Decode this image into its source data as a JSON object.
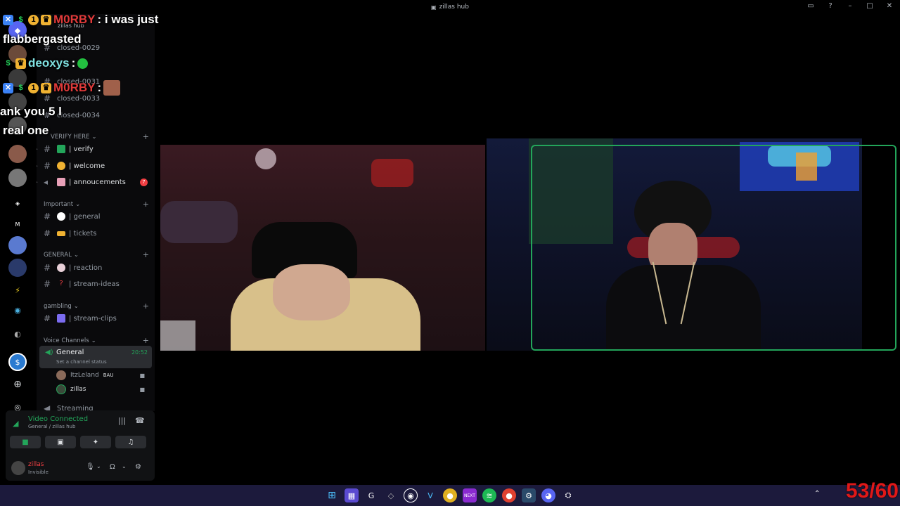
{
  "window": {
    "title": "zillas hub"
  },
  "chat_overlay": [
    {
      "user": "M0RBY",
      "text": ": i was just"
    },
    {
      "text": "flabbergasted"
    },
    {
      "user": "deoxys",
      "text": ":"
    },
    {
      "user": "M0RBY",
      "text": ":"
    },
    {
      "text": "ank you 5 l"
    },
    {
      "text": "real one"
    }
  ],
  "sidebar": {
    "server_name": "zillas hub",
    "closed": [
      "closed-0029",
      "closed-0031",
      "closed-0033",
      "closed-0034"
    ],
    "cat_verify": "VERIFY HERE",
    "verify_channels": [
      {
        "label": "| verify",
        "icon": "check-icon",
        "color": "#23a55a"
      },
      {
        "label": "| welcome",
        "icon": "wave-icon",
        "color": "#f0b232"
      },
      {
        "label": "| annoucements",
        "icon": "megaphone-icon",
        "color": "#e8a0b8",
        "badge": "7"
      }
    ],
    "cat_important": "Important",
    "important_channels": [
      {
        "label": "| general",
        "icon": "speech-icon",
        "color": "#ffffff"
      },
      {
        "label": "| tickets",
        "icon": "ticket-icon",
        "color": "#f0b232"
      }
    ],
    "cat_general": "GENERAL",
    "general_channels": [
      {
        "label": "| reaction",
        "icon": "face-icon",
        "color": "#e8d0d8"
      },
      {
        "label": "| stream-ideas",
        "icon": "question-icon",
        "color": "#f23f43"
      }
    ],
    "cat_gambling": "gambling",
    "gambling_channels": [
      {
        "label": "| stream-clips",
        "icon": "clip-icon",
        "color": "#7b6cf0"
      }
    ],
    "cat_voice": "Voice Channels",
    "voice": {
      "name": "General",
      "time": "20:52",
      "status": "Set a channel status",
      "users": [
        {
          "name": "ItzLeland",
          "tag": "BAU"
        },
        {
          "name": "zillas"
        }
      ],
      "next": "Streaming"
    }
  },
  "voice_panel": {
    "title": "Video Connected",
    "subtitle": "General / zillas hub",
    "user": "zillas",
    "user_status": "Invisible"
  },
  "fps": "53/60",
  "colors": {
    "accent": "#23a55a",
    "danger": "#f23f43",
    "bg": "#000000"
  }
}
